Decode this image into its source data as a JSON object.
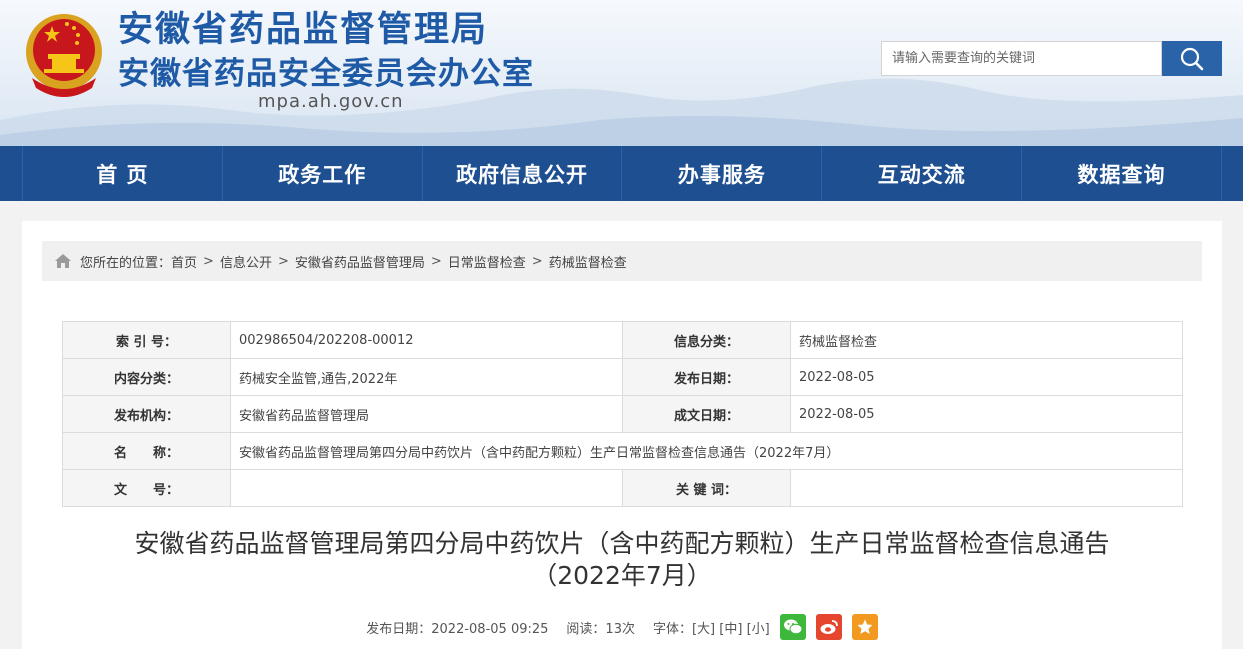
{
  "header": {
    "title": "安徽省药品监督管理局",
    "subtitle": "安徽省药品安全委员会办公室",
    "domain": "mpa.ah.gov.cn",
    "search_placeholder": "请输入需要查询的关键词"
  },
  "nav": {
    "items": [
      "首 页",
      "政务工作",
      "政府信息公开",
      "办事服务",
      "互动交流",
      "数据查询"
    ]
  },
  "breadcrumb": {
    "prefix": "您所在的位置：",
    "items": [
      "首页",
      "信息公开",
      "安徽省药品监督管理局",
      "日常监督检查",
      "药械监督检查"
    ],
    "separator": ">"
  },
  "meta_table": {
    "index_label": "索 引 号：",
    "index_value": "002986504/202208-00012",
    "category_label": "信息分类：",
    "category_value": "药械监督检查",
    "content_type_label": "内容分类：",
    "content_type_value": "药械安全监管,通告,2022年",
    "publish_date_label": "发布日期：",
    "publish_date_value": "2022-08-05",
    "publisher_label": "发布机构：",
    "publisher_value": "安徽省药品监督管理局",
    "written_date_label": "成文日期：",
    "written_date_value": "2022-08-05",
    "name_label": "名　　称：",
    "name_value": "安徽省药品监督管理局第四分局中药饮片（含中药配方颗粒）生产日常监督检查信息通告（2022年7月）",
    "doc_no_label": "文　　号：",
    "doc_no_value": "",
    "keywords_label": "关 键 词：",
    "keywords_value": ""
  },
  "article": {
    "title_line1": "安徽省药品监督管理局第四分局中药饮片（含中药配方颗粒）生产日常监督检查信息通告",
    "title_line2": "（2022年7月）",
    "publish": "发布日期：2022-08-05 09:25",
    "views": "阅读：13次",
    "font_label": "字体：",
    "font_large": "[大]",
    "font_medium": "[中]",
    "font_small": "[小]"
  },
  "share": {
    "wechat_color": "#3db83a",
    "weibo_color": "#e6462e",
    "favorite_color": "#f29a1f"
  },
  "colors": {
    "brand_blue": "#1f5aa6",
    "nav_bg": "#1e4f90",
    "search_button": "#2a63a8"
  }
}
